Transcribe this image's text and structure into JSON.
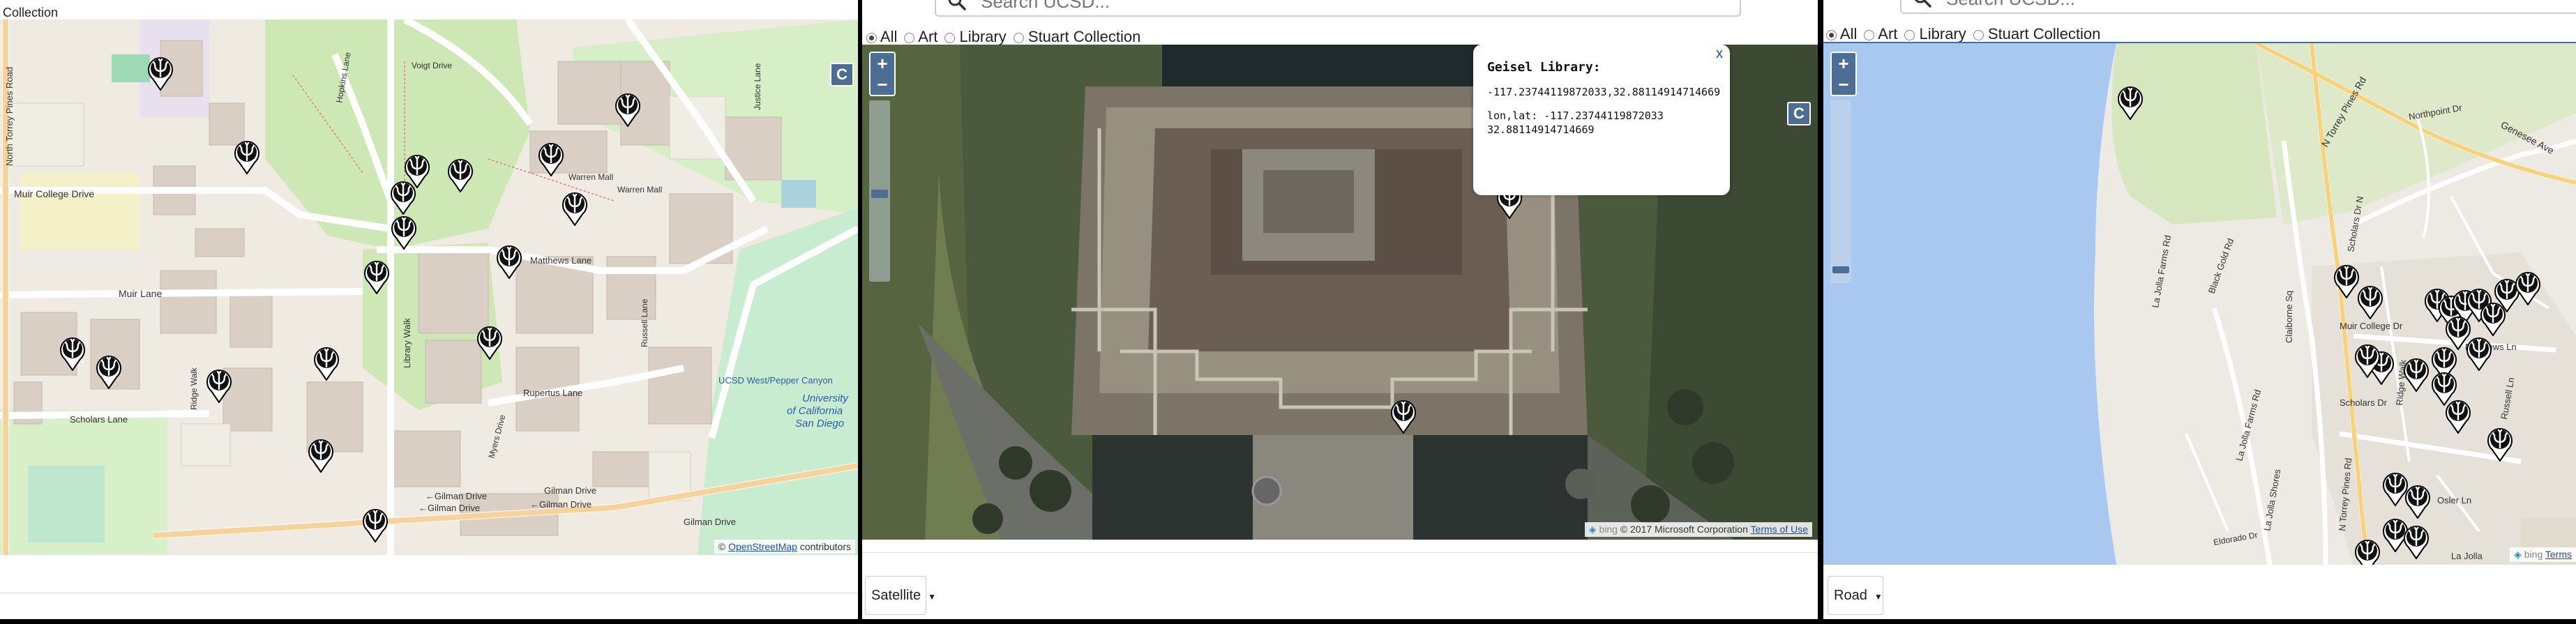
{
  "panel1": {
    "title": "Collection",
    "control_c": "C",
    "attribution_prefix": "©",
    "attribution_link": "OpenStreetMap",
    "attribution_suffix": "contributors",
    "labels": {
      "road_north_torrey": "North Torrey Pines Road",
      "muir_college_drive": "Muir College Drive",
      "muir_lane": "Muir Lane",
      "scholars_lane": "Scholars Lane",
      "gilman_1": "←Gilman Drive",
      "gilman_2": "←Gilman Drive",
      "gilman_3": "Gilman Drive",
      "gilman_4": "←Gilman Drive",
      "gilman_5": "Gilman Drive",
      "matthews_lane": "Matthews Lane",
      "rupertus_lane": "Rupertus Lane",
      "library_walk": "Library Walk",
      "hopkins_lane": "Hopkins Lane",
      "voigt_drive": "Voigt Drive",
      "warren_mall": "Warren Mall",
      "warren_mall_2": "Warren Mall",
      "ucsd_west": "UCSD West/Pepper Canyon",
      "university_1": "University",
      "university_2": "of California",
      "university_3": "San Diego",
      "russell_lane": "Russell Lane",
      "ridge_walk": "Ridge Walk",
      "myers_drive": "Myers Drive",
      "justice_lane": "Justice Lane"
    }
  },
  "panel2": {
    "search_placeholder": "Search UCSD...",
    "radios": [
      {
        "label": "All",
        "checked": true
      },
      {
        "label": "Art",
        "checked": false
      },
      {
        "label": "Library",
        "checked": false
      },
      {
        "label": "Stuart Collection",
        "checked": false
      }
    ],
    "zoom_in": "+",
    "zoom_out": "−",
    "control_c": "C",
    "popup": {
      "close": "x",
      "title": "Geisel Library:",
      "coords": "-117.23744119872033,32.88114914714669",
      "lonlat_line1": "lon,lat: -117.23744119872033",
      "lonlat_line2": "32.88114914714669"
    },
    "attribution_bing": "bing",
    "attribution_text": "© 2017 Microsoft Corporation",
    "attribution_link": "Terms of Use",
    "layer_select": "Satellite"
  },
  "panel3": {
    "search_placeholder": "Search UCSD...",
    "radios": [
      {
        "label": "All",
        "checked": true
      },
      {
        "label": "Art",
        "checked": false
      },
      {
        "label": "Library",
        "checked": false
      },
      {
        "label": "Stuart Collection",
        "checked": false
      }
    ],
    "zoom_in": "+",
    "zoom_out": "−",
    "attribution_bing": "bing",
    "attribution_link": "Terms",
    "layer_select": "Road",
    "labels": {
      "n_torrey_pines_rd": "N Torrey Pines Rd",
      "genesee_ave": "Genesee Ave",
      "northpoint_dr": "Northpoint Dr",
      "la_jolla_farms_rd": "La Jolla Farms Rd",
      "black_gold_rd": "Black Gold Rd",
      "claiborne_sq": "Claiborne Sq",
      "scholars_dr_n": "Scholars Dr N",
      "muir_college_dr": "Muir College Dr",
      "matthews_ln": "Matthews Ln",
      "scholars_dr": "Scholars Dr",
      "ridge_walk": "Ridge Walk",
      "russell_ln": "Russell Ln",
      "osler_ln": "Osler Ln",
      "la_jolla_shores": "La Jolla Shores",
      "la_jolla_village": "La Jolla",
      "eldorado_dr": "Eldorado Dr",
      "torrey_pines_rd": "N Torrey Pines Rd",
      "la_jolla_farms_2": "La Jolla Farms Rd"
    }
  }
}
